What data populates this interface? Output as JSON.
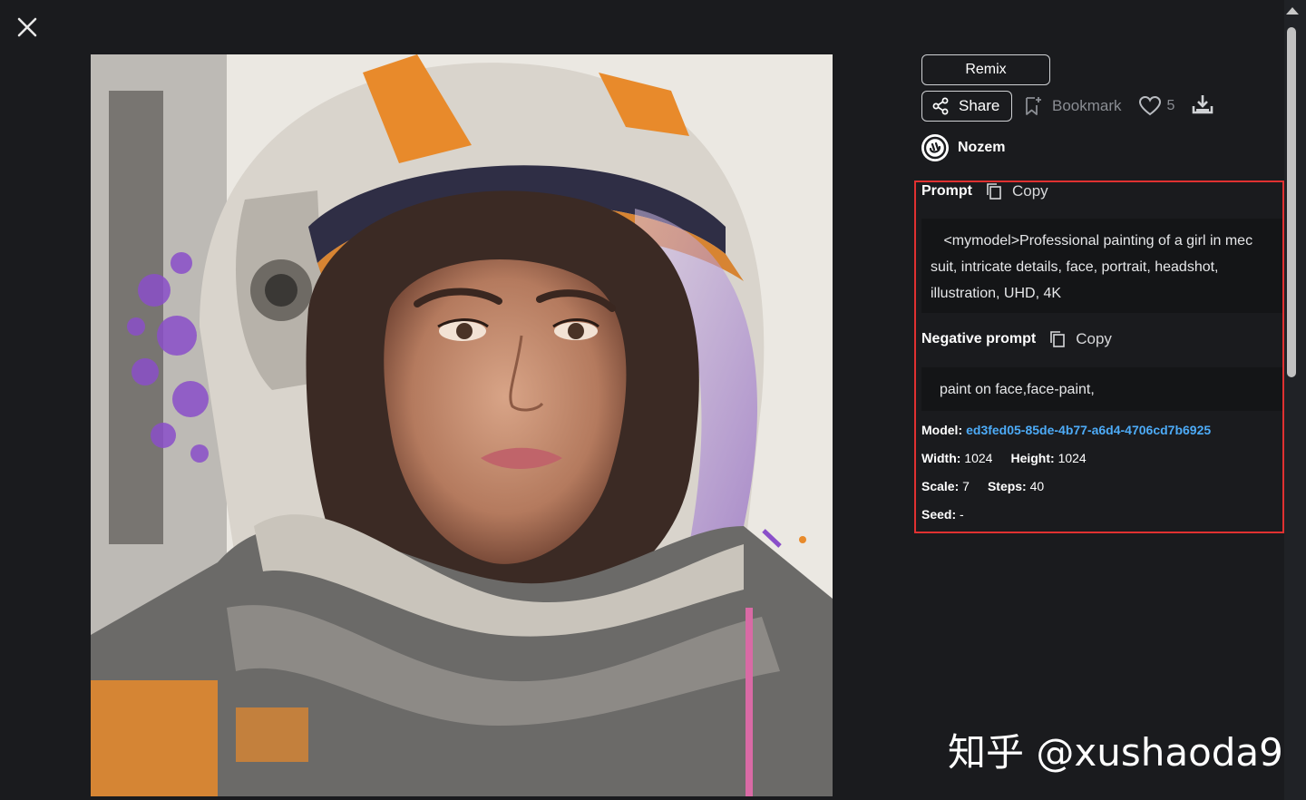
{
  "actions": {
    "remix_label": "Remix",
    "share_label": "Share",
    "bookmark_label": "Bookmark",
    "like_count": "5"
  },
  "author": {
    "name": "Nozem"
  },
  "prompt": {
    "label": "Prompt",
    "copy_label": "Copy",
    "text_line1": " <mymodel>Professional painting of a girl in mec",
    "text_line2": "suit, intricate details, face, portrait, headshot,",
    "text_line3": "illustration, UHD, 4K"
  },
  "negative_prompt": {
    "label": "Negative prompt",
    "copy_label": "Copy",
    "text": "paint on face,face-paint,"
  },
  "meta": {
    "model_key": "Model:",
    "model_value": "ed3fed05-85de-4b77-a6d4-4706cd7b6925",
    "width_key": "Width:",
    "width_value": "1024",
    "height_key": "Height:",
    "height_value": "1024",
    "scale_key": "Scale:",
    "scale_value": "7",
    "steps_key": "Steps:",
    "steps_value": "40",
    "seed_key": "Seed:",
    "seed_value": "-"
  },
  "watermark": "知乎 @xushaoda9",
  "icons": {
    "close": "close-icon",
    "share": "share-icon",
    "bookmark": "bookmark-icon",
    "like": "heart-icon",
    "download": "download-icon",
    "copy": "copy-icon",
    "avatar": "civitai-logo-icon"
  },
  "colors": {
    "background": "#1a1b1e",
    "highlight_border": "#e03131",
    "link": "#4dabf7",
    "muted": "#8a8d93"
  }
}
